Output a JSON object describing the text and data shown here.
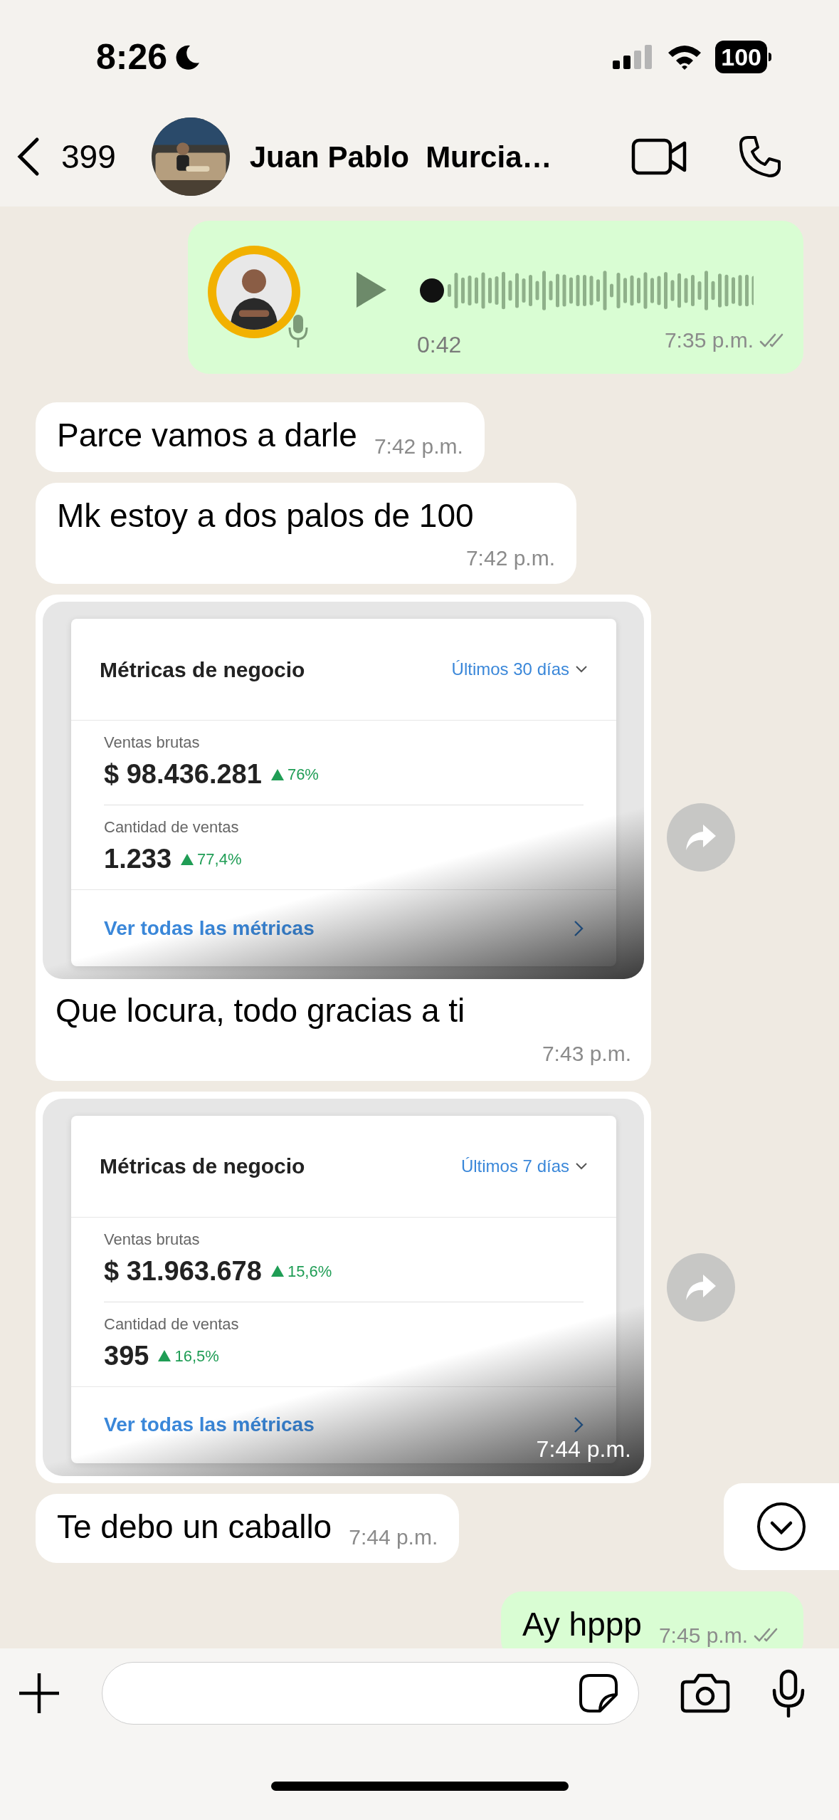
{
  "status_bar": {
    "time": "8:26",
    "battery": "100"
  },
  "header": {
    "back_count": "399",
    "contact_name": "Juan Pablo  Murcia…"
  },
  "messages": [
    {
      "kind": "voice",
      "outgoing": true,
      "duration": "0:42",
      "time": "7:35 p.m.",
      "read": false
    },
    {
      "kind": "text",
      "outgoing": false,
      "text": "Parce vamos a darle",
      "time": "7:42 p.m."
    },
    {
      "kind": "text",
      "outgoing": false,
      "text": "Mk estoy a dos palos de 100",
      "time": "7:42 p.m."
    },
    {
      "outgoing": false,
      "screenshot": {
        "title": "Métricas de negocio",
        "period": "Últimos 30 días",
        "metrics": [
          {
            "label": "Ventas brutas",
            "value": "$ 98.436.281",
            "change": "76%"
          },
          {
            "label": "Cantidad de ventas",
            "value": "1.233",
            "change": "77,4%"
          }
        ],
        "link": "Ver todas las métricas"
      },
      "caption": "Que locura, todo gracias a ti",
      "time": "7:43 p.m."
    },
    {
      "outgoing": false,
      "screenshot": {
        "title": "Métricas de negocio",
        "period": "Últimos 7 días",
        "metrics": [
          {
            "label": "Ventas brutas",
            "value": "$ 31.963.678",
            "change": "15,6%"
          },
          {
            "label": "Cantidad de ventas",
            "value": "395",
            "change": "16,5%"
          }
        ],
        "link": "Ver todas las métricas"
      },
      "time": "7:44 p.m."
    },
    {
      "kind": "text",
      "outgoing": false,
      "text": "Te debo un caballo",
      "time": "7:44 p.m."
    },
    {
      "kind": "text",
      "outgoing": true,
      "text": "Ay hppp",
      "time": "7:45 p.m.",
      "read": false
    }
  ]
}
